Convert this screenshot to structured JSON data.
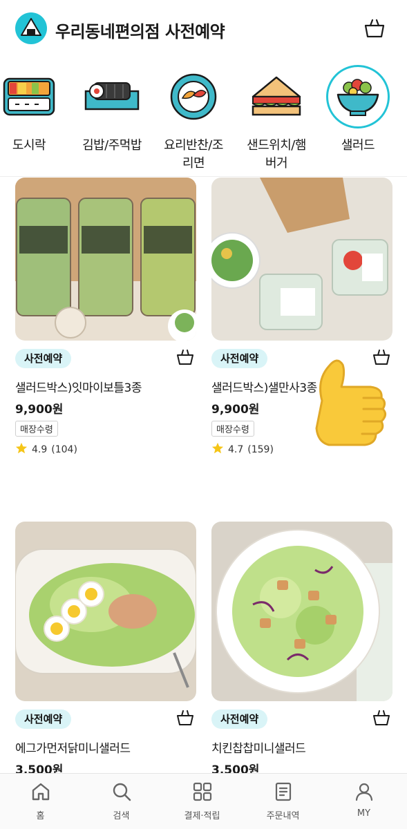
{
  "header": {
    "title": "우리동네편의점 사전예약",
    "logo_icon": "rice-ball-logo-icon",
    "cart_icon": "basket-icon"
  },
  "categories": [
    {
      "label": "도시락",
      "icon": "lunchbox-icon",
      "selected": false
    },
    {
      "label": "김밥/주먹밥",
      "icon": "kimbap-icon",
      "selected": false
    },
    {
      "label": "요리반찬/조\n리면",
      "icon": "side-dish-plate-icon",
      "selected": false
    },
    {
      "label": "샌드위치/햄\n버거",
      "icon": "sandwich-icon",
      "selected": false
    },
    {
      "label": "샐러드",
      "icon": "salad-bowl-icon",
      "selected": true
    }
  ],
  "products": [
    {
      "badge": "사전예약",
      "name": "샐러드박스)잇마이보틀3종",
      "price": "9,900원",
      "pickup": "매장수령",
      "rating": "4.9",
      "reviews": "(104)"
    },
    {
      "badge": "사전예약",
      "name": "샐러드박스)샐만사3종",
      "price": "9,900원",
      "pickup": "매장수령",
      "rating": "4.7",
      "reviews": "(159)"
    },
    {
      "badge": "사전예약",
      "name": "에그가먼저닭미니샐러드",
      "price": "3,500원"
    },
    {
      "badge": "사전예약",
      "name": "치킨찹찹미니샐러드",
      "price": "3,500원"
    }
  ],
  "bottom_nav": [
    {
      "label": "홈",
      "icon": "home-icon"
    },
    {
      "label": "검색",
      "icon": "search-icon"
    },
    {
      "label": "결제·적립",
      "icon": "qr-pay-icon"
    },
    {
      "label": "주문내역",
      "icon": "order-history-icon"
    },
    {
      "label": "MY",
      "icon": "user-icon"
    }
  ],
  "colors": {
    "accent": "#22c3d6",
    "badge_bg": "#d9f4f7",
    "star": "#f5c518"
  }
}
